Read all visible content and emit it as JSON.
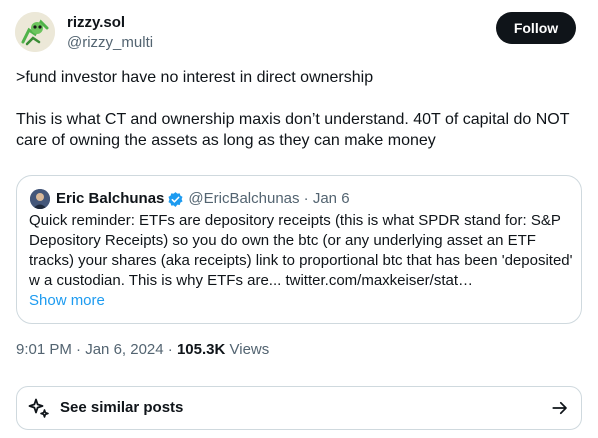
{
  "author": {
    "name": "rizzy.sol",
    "handle": "@rizzy_multi"
  },
  "follow_label": "Follow",
  "tweet": {
    "line1": ">fund investor have no interest in direct ownership",
    "line2": "This is what CT and ownership maxis don’t understand. 40T of capital do NOT care of owning the assets as long as they can make money"
  },
  "quote": {
    "name": "Eric Balchunas",
    "handle": "@EricBalchunas",
    "date": "Jan 6",
    "text": "Quick reminder: ETFs are depository receipts (this is what SPDR stand for: S&P Depository Receipts) so you do own the btc (or any underlying asset an ETF tracks) your shares (aka receipts) link to proportional btc that has been 'deposited' w a custodian. This is why ETFs are... twitter.com/maxkeiser/stat…",
    "show_more": "Show more"
  },
  "meta": {
    "time": "9:01 PM",
    "date": "Jan 6, 2024",
    "views_count": "105.3K",
    "views_label": "Views"
  },
  "similar_posts_label": "See similar posts",
  "colors": {
    "accent": "#1d9bf0",
    "text": "#0f1419",
    "secondary": "#536471",
    "border": "#cfd9de"
  }
}
